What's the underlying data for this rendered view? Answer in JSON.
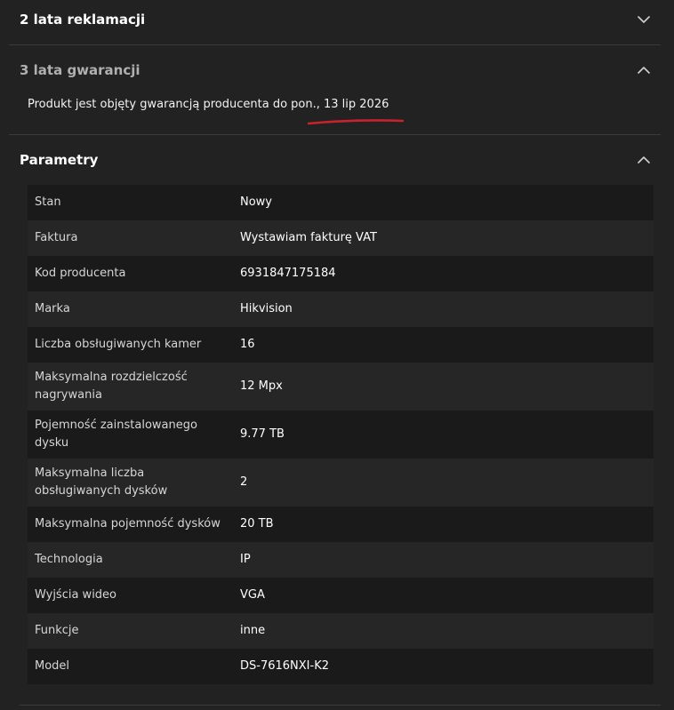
{
  "sections": {
    "reklamacja": {
      "title": "2 lata reklamacji",
      "expanded": false
    },
    "gwarancja": {
      "title": "3 lata gwarancji",
      "expanded": true,
      "text": "Produkt jest objęty gwarancją producenta do pon., 13 lip 2026",
      "highlight_color": "#c8232c"
    },
    "parametry": {
      "title": "Parametry",
      "expanded": true,
      "rows": [
        {
          "label": "Stan",
          "value": "Nowy"
        },
        {
          "label": "Faktura",
          "value": "Wystawiam fakturę VAT"
        },
        {
          "label": "Kod producenta",
          "value": "6931847175184"
        },
        {
          "label": "Marka",
          "value": "Hikvision"
        },
        {
          "label": "Liczba obsługiwanych kamer",
          "value": "16"
        },
        {
          "label": "Maksymalna rozdzielczość nagrywania",
          "value": "12 Mpx"
        },
        {
          "label": "Pojemność zainstalowanego dysku",
          "value": "9.77 TB"
        },
        {
          "label": "Maksymalna liczba obsługiwanych dysków",
          "value": "2"
        },
        {
          "label": "Maksymalna pojemność dysków",
          "value": "20 TB"
        },
        {
          "label": "Technologia",
          "value": "IP"
        },
        {
          "label": "Wyjścia wideo",
          "value": "VGA"
        },
        {
          "label": "Funkcje",
          "value": "inne"
        },
        {
          "label": "Model",
          "value": "DS-7616NXI-K2"
        }
      ]
    }
  },
  "icons": {
    "collapsed": "chevron-down-icon",
    "expanded": "chevron-up-icon"
  },
  "colors": {
    "background": "#222222",
    "row_dark": "#1a1a1a",
    "row_light": "#262626",
    "divider": "#3b3b3b"
  }
}
